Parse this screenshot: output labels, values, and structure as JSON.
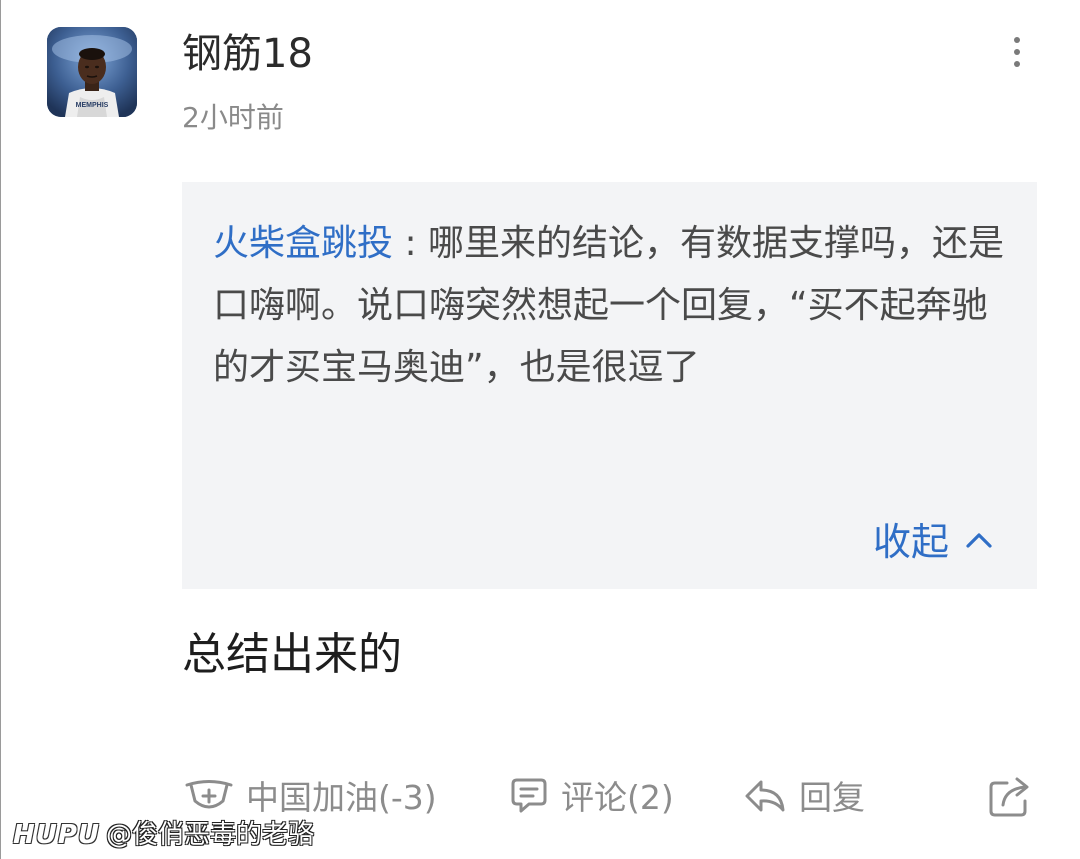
{
  "post": {
    "username": "钢筋18",
    "time": "2小时前",
    "more_icon": "more-vertical-icon",
    "avatar_icon": "basketball-player-avatar"
  },
  "quote": {
    "author": "火柴盒跳投",
    "separator": " : ",
    "text": "哪里来的结论，有数据支撑吗，还是口嗨啊。说口嗨突然想起一个回复，“买不起奔驰的才买宝马奥迪”，也是很逗了",
    "collapse_label": "收起",
    "collapse_icon": "chevron-up-icon"
  },
  "comment": {
    "text": "总结出来的"
  },
  "actions": {
    "cheer_label": "中国加油(-3)",
    "cheer_icon": "mask-cross-icon",
    "comment_label": "评论(2)",
    "comment_icon": "speech-bubble-icon",
    "reply_label": "回复",
    "reply_icon": "reply-arrow-icon",
    "share_icon": "share-icon"
  },
  "watermark": {
    "logo": "HUPU",
    "user": "@俊俏恶毒的老骆"
  },
  "colors": {
    "link_blue": "#2f6ec6",
    "quote_bg": "#f3f4f6",
    "muted_gray": "#8c8c8c"
  }
}
